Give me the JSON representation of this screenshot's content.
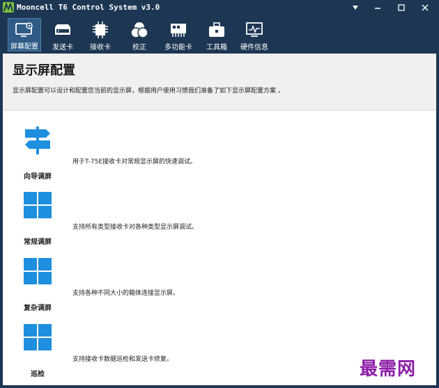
{
  "window": {
    "title": "Mooncell T6 Control System v3.0",
    "colors": {
      "chrome": "#1d3653",
      "active_tab": "#2f5b86",
      "tile_blue": "#1e8fde",
      "logo_green": "#7cc53a"
    }
  },
  "toolbar": {
    "items": [
      {
        "label": "屏幕配置",
        "icon": "monitor-gear-icon",
        "active": true
      },
      {
        "label": "发送卡",
        "icon": "sender-card-icon",
        "active": false
      },
      {
        "label": "接收卡",
        "icon": "chip-icon",
        "active": false
      },
      {
        "label": "校正",
        "icon": "color-circles-icon",
        "active": false
      },
      {
        "label": "多功能卡",
        "icon": "multifunction-card-icon",
        "active": false
      },
      {
        "label": "工具箱",
        "icon": "toolbox-icon",
        "active": false
      },
      {
        "label": "硬件信息",
        "icon": "hardware-monitor-icon",
        "active": false
      }
    ]
  },
  "header": {
    "title": "显示屏配置",
    "description": "显示屏配置可以设计和配置您当前的显示屏，根据用户使用习惯我们准备了如下显示屏配置方案 。"
  },
  "options": [
    {
      "name": "向导调屏",
      "description": "用于T-75E接收卡对常规显示屏的快速调试。",
      "icon": "signpost-icon"
    },
    {
      "name": "常规调屏",
      "description": "支持所有类型接收卡对各种类型显示屏调试。",
      "icon": "grid-tiles-icon"
    },
    {
      "name": "复杂调屏",
      "description": "支持各种不同大小的箱体连接显示屏。",
      "icon": "grid-tiles-icon"
    },
    {
      "name": "巡检",
      "description": "支持接收卡数据巡检和发送卡修复。",
      "icon": "grid-tiles-icon"
    }
  ],
  "watermark": "最需网"
}
